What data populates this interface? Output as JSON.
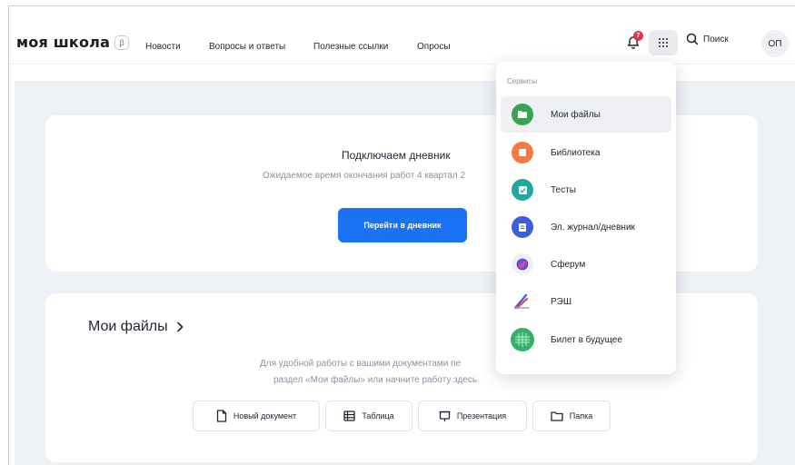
{
  "header": {
    "logo": "моя школа",
    "beta": "β",
    "nav": [
      "Новости",
      "Вопросы и ответы",
      "Полезные ссылки",
      "Опросы"
    ],
    "notifications_count": "7",
    "search_label": "Поиск",
    "avatar_initials": "ОП"
  },
  "diary": {
    "title": "Подключаем дневник",
    "subtitle": "Ожидаемое время окончания работ 4 квартал 2",
    "button": "Перейти в дневник"
  },
  "files": {
    "title": "Мои файлы",
    "desc_line1": "Для удобной работы с вашими документами пе",
    "desc_line2": "раздел «Мои файлы» или начните работу здесь",
    "buttons": [
      "Новый документ",
      "Таблица",
      "Презентация",
      "Папка"
    ]
  },
  "services": {
    "header": "Сервисы",
    "items": [
      {
        "label": "Мои файлы",
        "icon": "folder-icon",
        "color": "#3aa34f"
      },
      {
        "label": "Библиотека",
        "icon": "library-icon",
        "color": "#f47a45"
      },
      {
        "label": "Тесты",
        "icon": "tests-icon",
        "color": "#25a7a0"
      },
      {
        "label": "Эл. журнал/дневник",
        "icon": "journal-icon",
        "color": "#3a5fe0"
      },
      {
        "label": "Сферум",
        "icon": "sferum-icon",
        "color": "#6a4cf0"
      },
      {
        "label": "РЭШ",
        "icon": "resh-icon",
        "color": "#d9495a"
      },
      {
        "label": "Билет в будущее",
        "icon": "future-ticket-icon",
        "color": "#35b06a"
      }
    ]
  }
}
